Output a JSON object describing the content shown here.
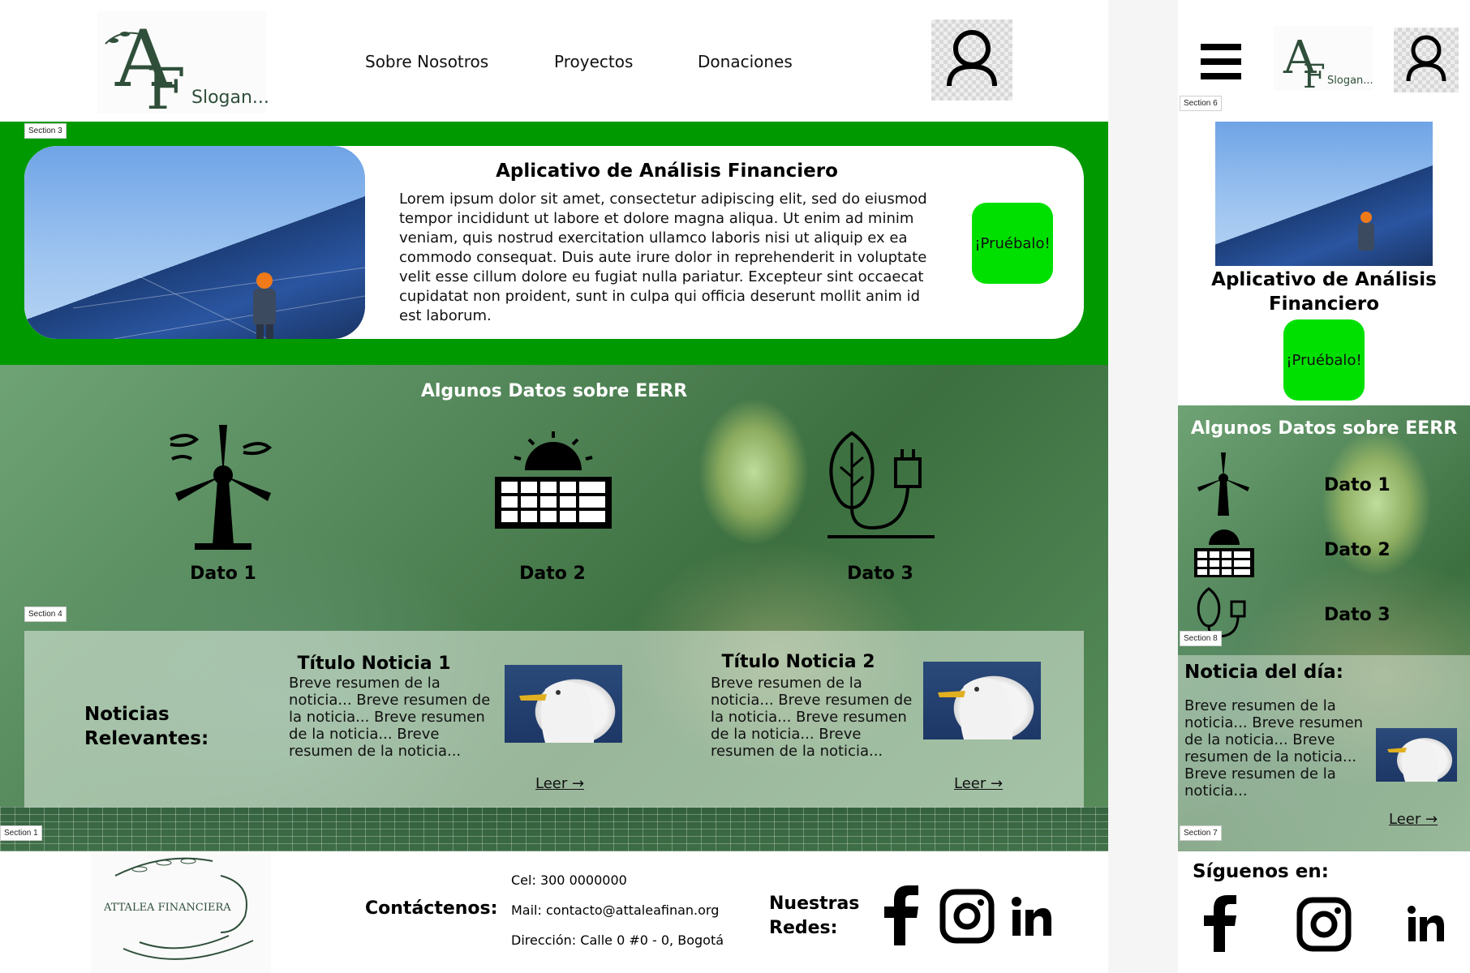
{
  "brand": {
    "logo_letters": "AF",
    "slogan": "Slogan..."
  },
  "nav": {
    "items": [
      "Sobre Nosotros",
      "Proyectos",
      "Donaciones"
    ]
  },
  "section_labels": {
    "s1": "Section 1",
    "s3": "Section 3",
    "s4": "Section 4",
    "s6": "Section 6",
    "s7": "Section 7",
    "s8": "Section 8"
  },
  "hero": {
    "title": "Aplicativo de Análisis Financiero",
    "body": "Lorem ipsum dolor sit amet, consectetur adipiscing elit, sed do eiusmod tempor incididunt ut labore et dolore magna aliqua. Ut enim ad minim veniam, quis nostrud exercitation ullamco laboris nisi ut aliquip ex ea commodo consequat. Duis aute irure dolor in reprehenderit in voluptate velit esse cillum dolore eu fugiat nulla pariatur. Excepteur sint occaecat cupidatat non proident, sunt in culpa qui officia deserunt mollit anim id est laborum.",
    "cta": "¡Pruébalo!",
    "mobile_title": "Aplicativo de Análisis Financiero"
  },
  "data_section": {
    "title": "Algunos Datos sobre EERR",
    "items": [
      {
        "label": "Dato 1",
        "icon": "wind-turbine-icon"
      },
      {
        "label": "Dato 2",
        "icon": "solar-panel-icon"
      },
      {
        "label": "Dato 3",
        "icon": "eco-plug-icon"
      }
    ]
  },
  "news": {
    "heading": "Noticias Relevantes:",
    "items": [
      {
        "title": "Título Noticia 1",
        "summary": "Breve resumen de la noticia... Breve resumen de la noticia... Breve resumen de la noticia... Breve resumen de la noticia...",
        "link": "Leer →"
      },
      {
        "title": "Título Noticia 2",
        "summary": "Breve resumen de la noticia... Breve resumen de la noticia... Breve resumen de la noticia... Breve resumen de la noticia...",
        "link": "Leer →"
      }
    ],
    "mobile_heading": "Noticia del día:",
    "mobile_summary": "Breve resumen de la noticia... Breve resumen de la noticia... Breve resumen de la noticia... Breve resumen de la noticia...",
    "mobile_link": "Leer →"
  },
  "footer": {
    "org_name": "ATTALEA FINANCIERA",
    "contact_label": "Contáctenos:",
    "phone": "Cel: 300 0000000",
    "email": "Mail: contacto@attaleafinan.org",
    "address": "Dirección: Calle 0 #0 - 0, Bogotá",
    "social_label": "Nuestras Redes:",
    "mobile_social_label": "Síguenos en:",
    "social": [
      "facebook-icon",
      "instagram-icon",
      "linkedin-icon"
    ]
  },
  "colors": {
    "primary_green": "#009900",
    "cta_green": "#00e000",
    "logo_green": "#2f4f3a"
  }
}
